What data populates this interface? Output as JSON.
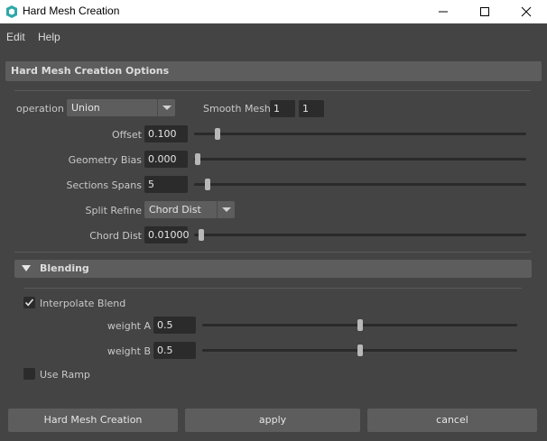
{
  "window": {
    "title": "Hard Mesh Creation"
  },
  "menu": {
    "items": [
      "Edit",
      "Help"
    ]
  },
  "section": {
    "title": "Hard Mesh Creation Options"
  },
  "options": {
    "operation": {
      "label": "operation",
      "value": "Union"
    },
    "smooth_mesh": {
      "label": "Smooth Mesh",
      "value1": "1",
      "value2": "1"
    },
    "offset": {
      "label": "Offset",
      "value": "0.100",
      "slider_fraction": 0.06
    },
    "geometry_bias": {
      "label": "Geometry Bias",
      "value": "0.000",
      "slider_fraction": 0.0
    },
    "sections_spans": {
      "label": "Sections Spans",
      "value": "5",
      "slider_fraction": 0.03
    },
    "split_refine": {
      "label": "Split Refine",
      "value": "Chord Dist"
    },
    "chord_dist": {
      "label": "Chord Dist",
      "value": "0.01000",
      "slider_fraction": 0.01
    }
  },
  "blending": {
    "title": "Blending",
    "interpolate_blend": {
      "label": "Interpolate Blend",
      "checked": true
    },
    "weight_a": {
      "label": "weight A",
      "value": "0.5",
      "slider_fraction": 0.5
    },
    "weight_b": {
      "label": "weight B",
      "value": "0.5",
      "slider_fraction": 0.5
    },
    "use_ramp": {
      "label": "Use Ramp",
      "checked": false
    }
  },
  "buttons": {
    "create": "Hard Mesh Creation",
    "apply": "apply",
    "cancel": "cancel"
  },
  "colors": {
    "background": "#444444",
    "field": "#2b2b2b",
    "header": "#5d5d5d",
    "icon_teal": "#2fa8a8"
  }
}
